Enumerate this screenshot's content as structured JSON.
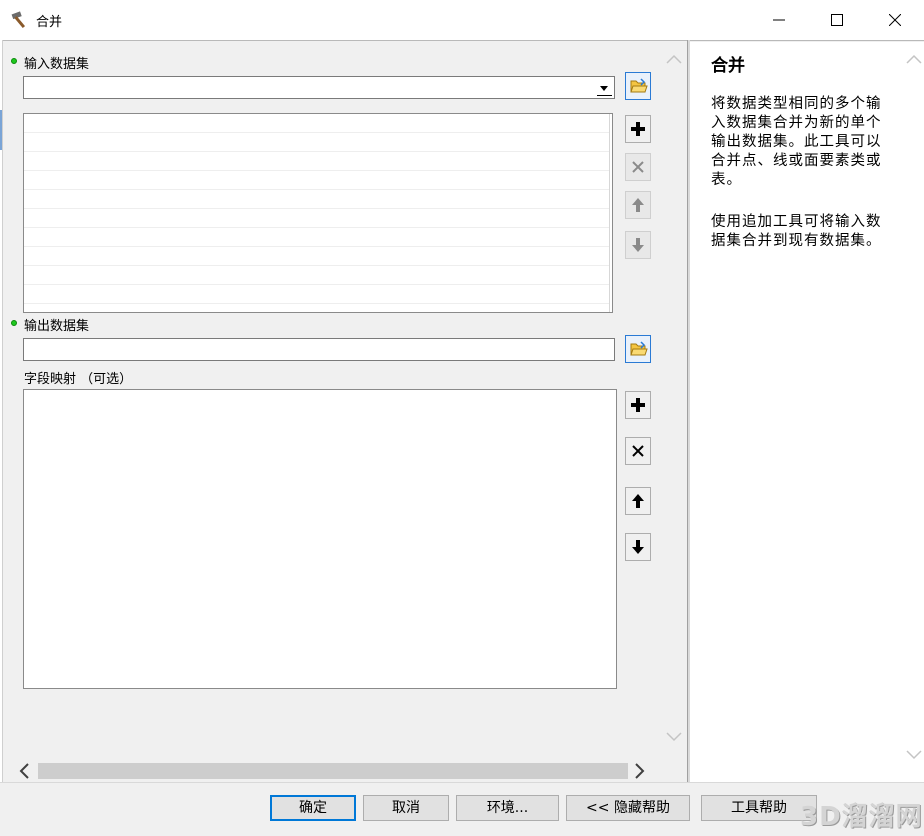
{
  "window": {
    "title": "合并",
    "controls": {
      "minimize": "minimize-icon",
      "maximize": "maximize-icon",
      "close": "close-icon"
    }
  },
  "params": {
    "input_datasets": {
      "label": "输入数据集",
      "value": ""
    },
    "output_dataset": {
      "label": "输出数据集",
      "value": ""
    },
    "field_mapping": {
      "label": "字段映射 （可选）"
    }
  },
  "help": {
    "title": "合并",
    "paragraph1": "将数据类型相同的多个输入数据集合并为新的单个输出数据集。此工具可以合并点、线或面要素类或表。",
    "paragraph2": "使用追加工具可将输入数据集合并到现有数据集。"
  },
  "buttons": {
    "ok": "确定",
    "cancel": "取消",
    "environments": "环境...",
    "hide_help": "<< 隐藏帮助",
    "tool_help": "工具帮助"
  },
  "watermark": "3D溜溜网",
  "colors": {
    "required_dot": "#1ec81e",
    "focus_border": "#0078d7"
  }
}
